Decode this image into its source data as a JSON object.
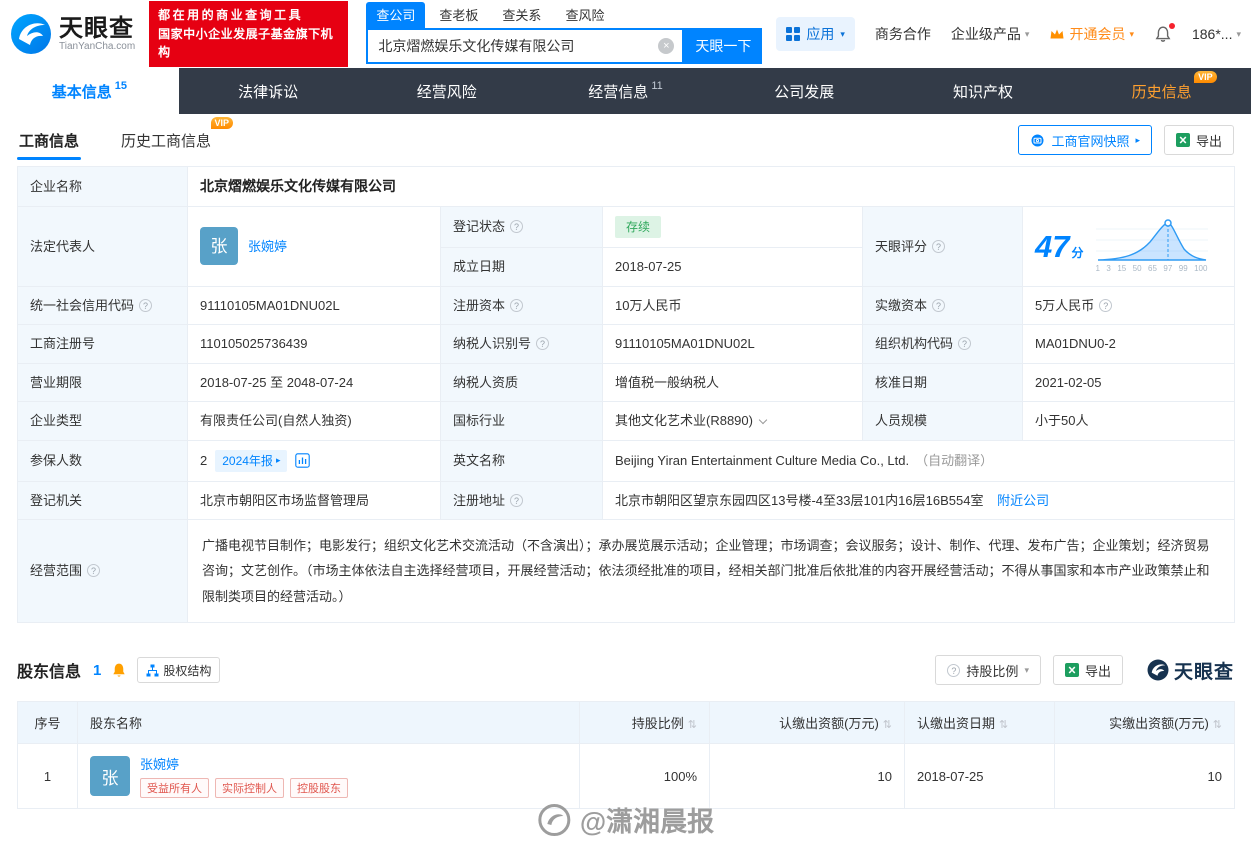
{
  "icons": {
    "help": "?",
    "caret_down": "▾",
    "caret_right": "▸",
    "close": "×",
    "vip": "VIP",
    "sort": "⇅"
  },
  "header": {
    "logo": {
      "title": "天眼查",
      "subtitle": "TianYanCha.com"
    },
    "promo": {
      "line1": "都在用的商业查询工具",
      "line2": "国家中小企业发展子基金旗下机构"
    },
    "search": {
      "tabs": [
        "查公司",
        "查老板",
        "查关系",
        "查风险"
      ],
      "value": "北京熠燃娱乐文化传媒有限公司",
      "button": "天眼一下"
    },
    "menu": {
      "app": "应用",
      "cooperation": "商务合作",
      "products": "企业级产品",
      "vip": "开通会员",
      "phone": "186*..."
    }
  },
  "nav": {
    "tabs": [
      {
        "label": "基本信息",
        "count": "15"
      },
      {
        "label": "法律诉讼"
      },
      {
        "label": "经营风险"
      },
      {
        "label": "经营信息",
        "count": "11"
      },
      {
        "label": "公司发展"
      },
      {
        "label": "知识产权"
      },
      {
        "label": "历史信息"
      }
    ]
  },
  "subtabs": {
    "business": "工商信息",
    "history": "历史工商信息",
    "snapshot": "工商官网快照",
    "export": "导出"
  },
  "info": {
    "name": {
      "label": "企业名称",
      "value": "北京熠燃娱乐文化传媒有限公司"
    },
    "legal_rep": {
      "label": "法定代表人",
      "avatar": "张",
      "value": "张婉婷"
    },
    "status": {
      "label": "登记状态",
      "value": "存续"
    },
    "est_date": {
      "label": "成立日期",
      "value": "2018-07-25"
    },
    "score": {
      "label": "天眼评分",
      "value": "47",
      "unit": "分",
      "ticks": [
        "1",
        "3",
        "15",
        "50",
        "65",
        "97",
        "99",
        "100"
      ]
    },
    "credit_code": {
      "label": "统一社会信用代码",
      "value": "91110105MA01DNU02L"
    },
    "reg_capital": {
      "label": "注册资本",
      "value": "10万人民币"
    },
    "paid_capital": {
      "label": "实缴资本",
      "value": "5万人民币"
    },
    "reg_no": {
      "label": "工商注册号",
      "value": "110105025736439"
    },
    "tax_id": {
      "label": "纳税人识别号",
      "value": "91110105MA01DNU02L"
    },
    "org_code": {
      "label": "组织机构代码",
      "value": "MA01DNU0-2"
    },
    "term": {
      "label": "营业期限",
      "value": "2018-07-25 至 2048-07-24"
    },
    "tax_quality": {
      "label": "纳税人资质",
      "value": "增值税一般纳税人"
    },
    "approve_date": {
      "label": "核准日期",
      "value": "2021-02-05"
    },
    "type": {
      "label": "企业类型",
      "value": "有限责任公司(自然人独资)"
    },
    "industry": {
      "label": "国标行业",
      "value": "其他文化艺术业(R8890)"
    },
    "staff": {
      "label": "人员规模",
      "value": "小于50人"
    },
    "insured": {
      "label": "参保人数",
      "value": "2",
      "badge": "2024年报"
    },
    "en_name": {
      "label": "英文名称",
      "value": "Beijing Yiran Entertainment Culture Media Co., Ltd.",
      "note": "（自动翻译）"
    },
    "authority": {
      "label": "登记机关",
      "value": "北京市朝阳区市场监督管理局"
    },
    "address": {
      "label": "注册地址",
      "value": "北京市朝阳区望京东园四区13号楼-4至33层101内16层16B554室",
      "link": "附近公司"
    },
    "scope": {
      "label": "经营范围",
      "value": "广播电视节目制作；电影发行；组织文化艺术交流活动（不含演出）；承办展览展示活动；企业管理；市场调查；会议服务；设计、制作、代理、发布广告；企业策划；经济贸易咨询；文艺创作。（市场主体依法自主选择经营项目，开展经营活动；依法须经批准的项目，经相关部门批准后依批准的内容开展经营活动；不得从事国家和本市产业政策禁止和限制类项目的经营活动。）"
    }
  },
  "shareholders": {
    "title": "股东信息",
    "count": "1",
    "structure": "股权结构",
    "ratio_btn": "持股比例",
    "export": "导出",
    "brand": "天眼查",
    "columns": [
      "序号",
      "股东名称",
      "持股比例",
      "认缴出资额(万元)",
      "认缴出资日期",
      "实缴出资额(万元)"
    ],
    "row": {
      "index": "1",
      "avatar": "张",
      "name": "张婉婷",
      "tags": [
        "受益所有人",
        "实际控制人",
        "控股股东"
      ],
      "ratio": "100%",
      "subscribed": "10",
      "date": "2018-07-25",
      "paid": "10"
    }
  },
  "watermark": "@潇湘晨报"
}
